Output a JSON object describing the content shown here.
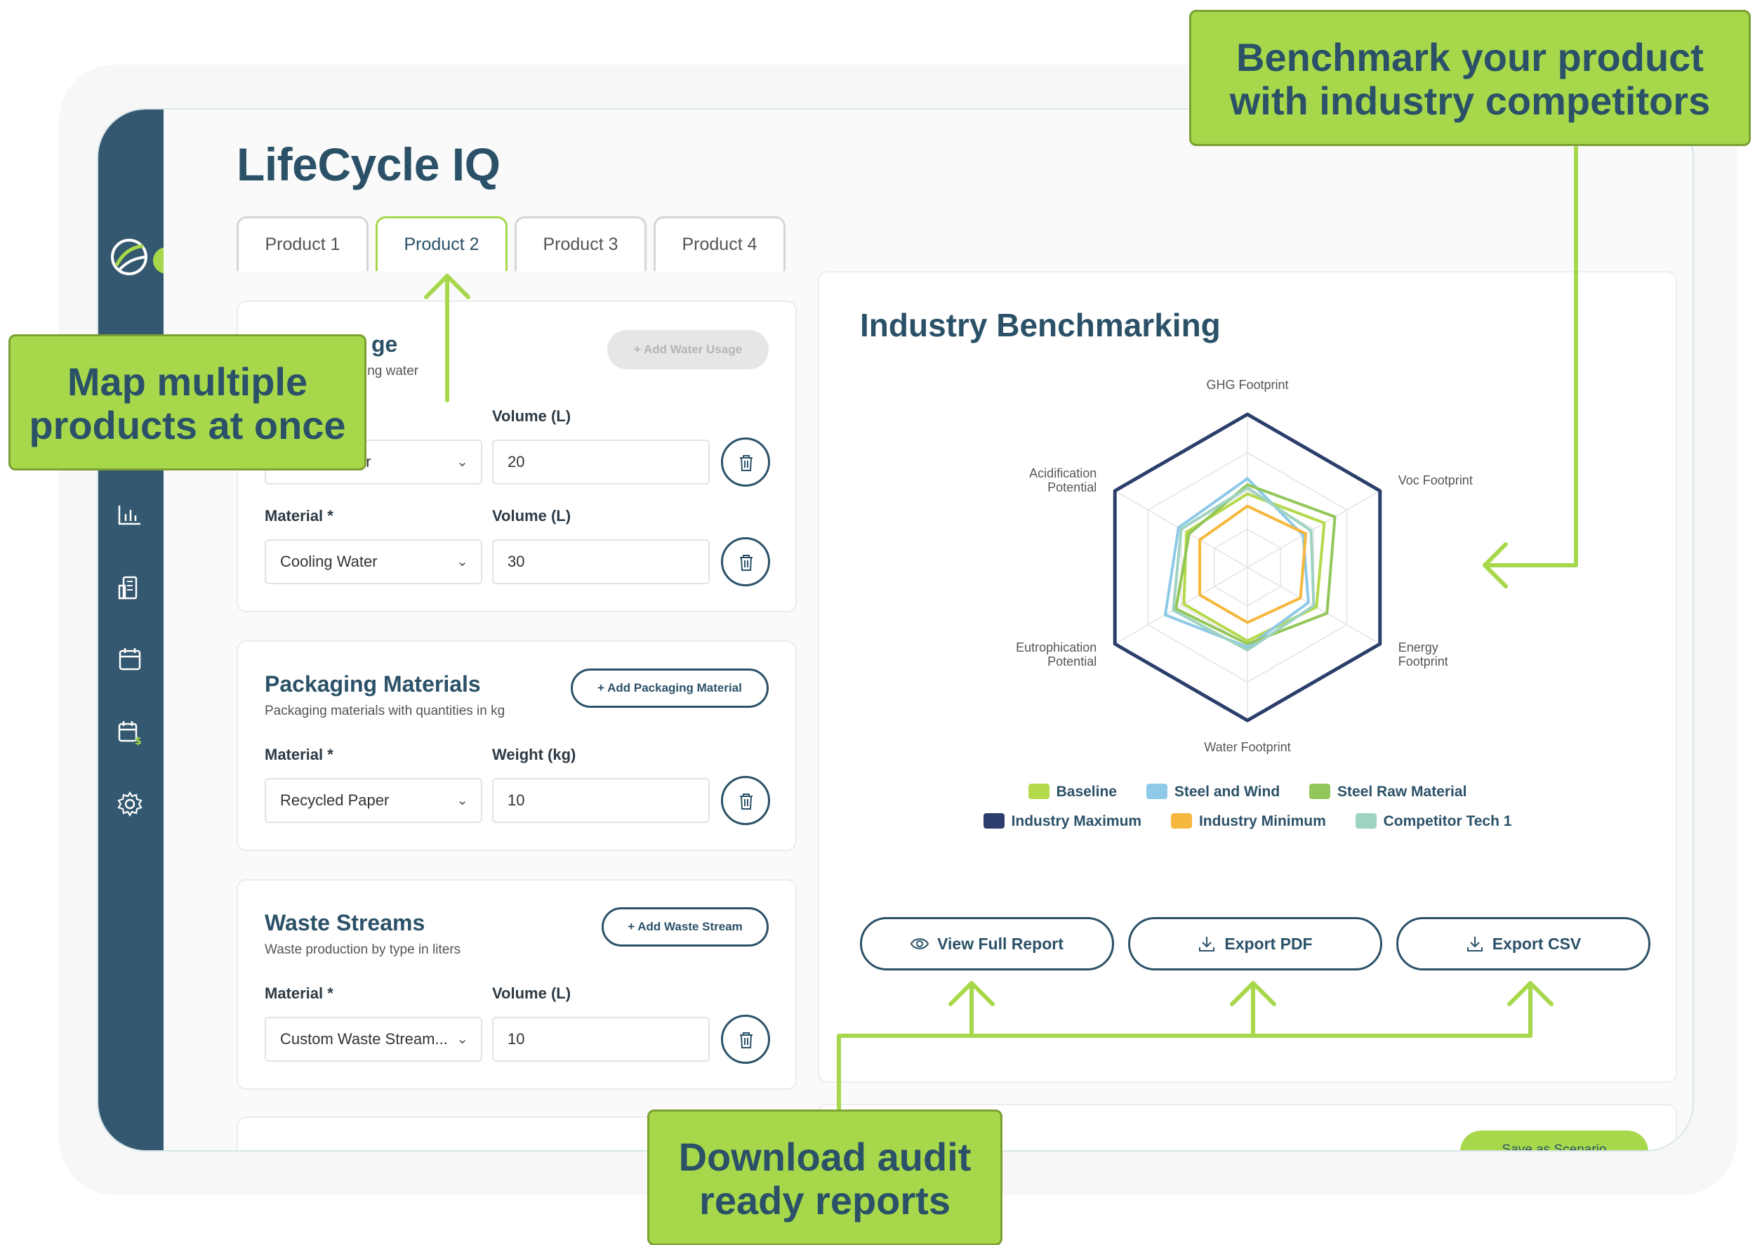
{
  "app": {
    "title": "LifeCycle IQ"
  },
  "tabs": [
    {
      "label": "Product 1"
    },
    {
      "label": "Product 2"
    },
    {
      "label": "Product 3"
    },
    {
      "label": "Product 4"
    }
  ],
  "water_usage": {
    "title_visible": "ge",
    "subtitle_visible": "ing water",
    "add_button": "+ Add Water Usage",
    "rows": [
      {
        "material_label": "Material *",
        "material": "er",
        "volume_label": "Volume (L)",
        "volume": "20"
      },
      {
        "material_label": "Material *",
        "material": "Cooling Water",
        "volume_label": "Volume (L)",
        "volume": "30"
      }
    ]
  },
  "packaging": {
    "title": "Packaging Materials",
    "subtitle": "Packaging materials with quantities in kg",
    "add_button": "+ Add Packaging Material",
    "material_label": "Material *",
    "material": "Recycled Paper",
    "weight_label": "Weight (kg)",
    "weight": "10"
  },
  "waste": {
    "title": "Waste Streams",
    "subtitle": "Waste production by type in liters",
    "add_button": "+ Add Waste Stream",
    "material_label": "Material *",
    "material": "Custom Waste Stream...",
    "volume_label": "Volume (L)",
    "volume": "10"
  },
  "benchmark": {
    "title": "Industry Benchmarking",
    "actions": {
      "view": "View Full Report",
      "pdf": "Export PDF",
      "csv": "Export CSV"
    }
  },
  "save": {
    "label": "Save as Scenario"
  },
  "callouts": {
    "benchmark_line1": "Benchmark your product",
    "benchmark_line2": "with industry competitors",
    "map_line1": "Map multiple",
    "map_line2": "products at once",
    "download_line1": "Download audit",
    "download_line2": "ready reports"
  },
  "colors": {
    "brand": "#2b5168",
    "accent": "#a7d84b",
    "sidebar": "#33586f"
  },
  "chart_data": {
    "type": "radar",
    "axes": [
      "GHG Footprint",
      "Voc Footprint",
      "Energy Footprint",
      "Water Footprint",
      "Eutrophication Potential",
      "Acidification Potential"
    ],
    "max": 100,
    "series": [
      {
        "name": "Baseline",
        "color": "#b4d94a",
        "values": [
          48,
          58,
          52,
          48,
          48,
          46
        ]
      },
      {
        "name": "Steel and Wind",
        "color": "#8ec9e8",
        "values": [
          58,
          42,
          46,
          52,
          62,
          52
        ]
      },
      {
        "name": "Steel Raw Material",
        "color": "#93c65a",
        "values": [
          54,
          66,
          60,
          50,
          54,
          44
        ]
      },
      {
        "name": "Industry Maximum",
        "color": "#2c3e6b",
        "values": [
          100,
          100,
          100,
          100,
          100,
          100
        ]
      },
      {
        "name": "Industry Minimum",
        "color": "#f5b73d",
        "values": [
          40,
          44,
          40,
          36,
          36,
          36
        ]
      },
      {
        "name": "Competitor Tech 1",
        "color": "#9fd3c1",
        "values": [
          52,
          48,
          50,
          54,
          56,
          50
        ]
      }
    ]
  }
}
